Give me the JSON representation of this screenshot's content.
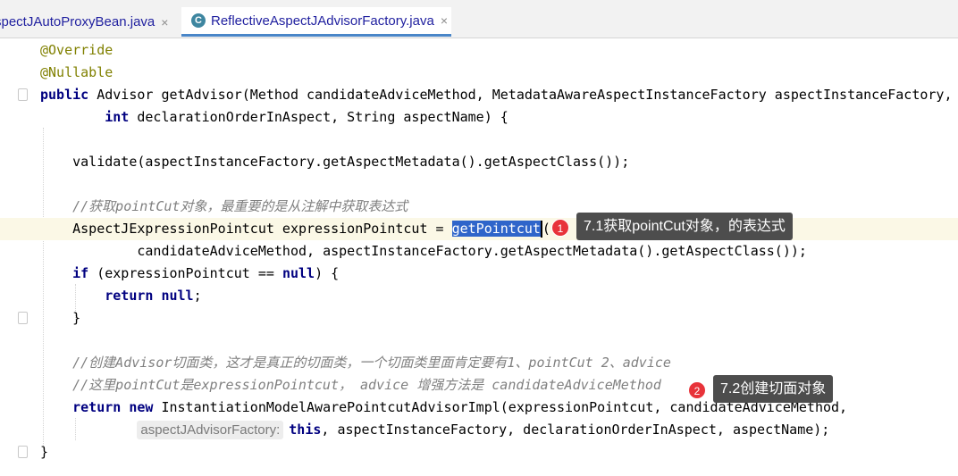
{
  "tabs": [
    {
      "label": "spectJAutoProxyBean.java",
      "close": "×"
    },
    {
      "label": "ReflectiveAspectJAdvisorFactory.java",
      "close": "×",
      "icon": "C"
    }
  ],
  "code": {
    "l1": "@Override",
    "l2": "@Nullable",
    "l3_kw": "public",
    "l3_rest": " Advisor getAdvisor(Method candidateAdviceMethod, MetadataAwareAspectInstanceFactory aspectInstanceFactory,",
    "l4_indent": "        ",
    "l4_kw": "int",
    "l4_rest": " declarationOrderInAspect, String aspectName) {",
    "l6": "    validate(aspectInstanceFactory.getAspectMetadata().getAspectClass());",
    "l8": "    //获取pointCut对象，最重要的是从注解中获取表达式",
    "l9_pre": "    AspectJExpressionPointcut expressionPointcut = ",
    "l9_sel": "getPointcut",
    "l9_post": "(",
    "l10": "            candidateAdviceMethod, aspectInstanceFactory.getAspectMetadata().getAspectClass());",
    "l11_indent": "    ",
    "l11_kw": "if",
    "l11_mid": " (expressionPointcut == ",
    "l11_kw2": "null",
    "l11_rest": ") {",
    "l12_indent": "        ",
    "l12_kw": "return null",
    "l12_rest": ";",
    "l13": "    }",
    "l15": "    //创建Advisor切面类，这才是真正的切面类，一个切面类里面肯定要有1、pointCut 2、advice",
    "l16": "    //这里pointCut是expressionPointcut， advice 增强方法是 candidateAdviceMethod",
    "l17_indent": "    ",
    "l17_kw1": "return",
    "l17_sp": " ",
    "l17_kw2": "new",
    "l17_rest": " InstantiationModelAwarePointcutAdvisorImpl(expressionPointcut, candidateAdviceMethod,",
    "l18_indent": "            ",
    "l18_hint": "aspectJAdvisorFactory:",
    "l18_kw": "this",
    "l18_rest": ", aspectInstanceFactory, declarationOrderInAspect, aspectName);",
    "l19": "}"
  },
  "annotations": [
    {
      "badge": "1",
      "text": "7.1获取pointCut对象，的表达式"
    },
    {
      "badge": "2",
      "text": "7.2创建切面对象"
    }
  ]
}
